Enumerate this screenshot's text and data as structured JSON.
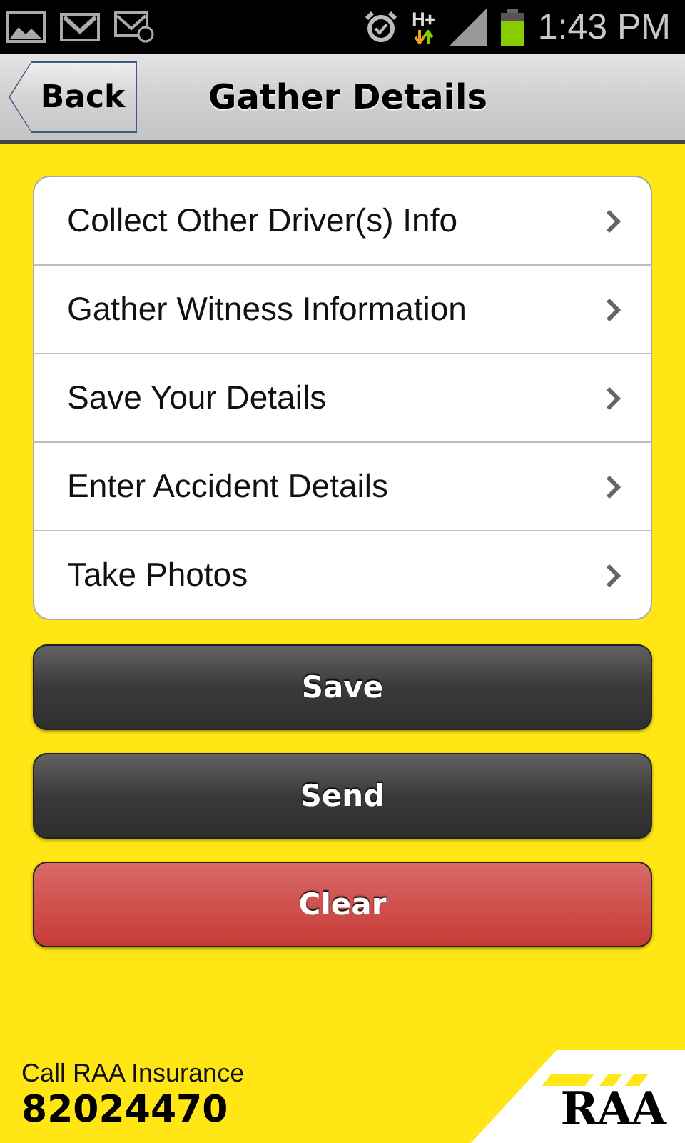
{
  "status_bar": {
    "network": "H+",
    "time": "1:43 PM"
  },
  "header": {
    "back": "Back",
    "title": "Gather Details"
  },
  "menu": [
    {
      "label": "Collect Other Driver(s) Info"
    },
    {
      "label": "Gather Witness Information"
    },
    {
      "label": "Save Your Details"
    },
    {
      "label": "Enter Accident Details"
    },
    {
      "label": "Take Photos"
    }
  ],
  "buttons": [
    {
      "label": "Save",
      "kind": "dark"
    },
    {
      "label": "Send",
      "kind": "dark"
    },
    {
      "label": "Clear",
      "kind": "danger"
    }
  ],
  "footer": {
    "caption": "Call RAA Insurance",
    "phone": "82024470",
    "logo": "RAA"
  }
}
